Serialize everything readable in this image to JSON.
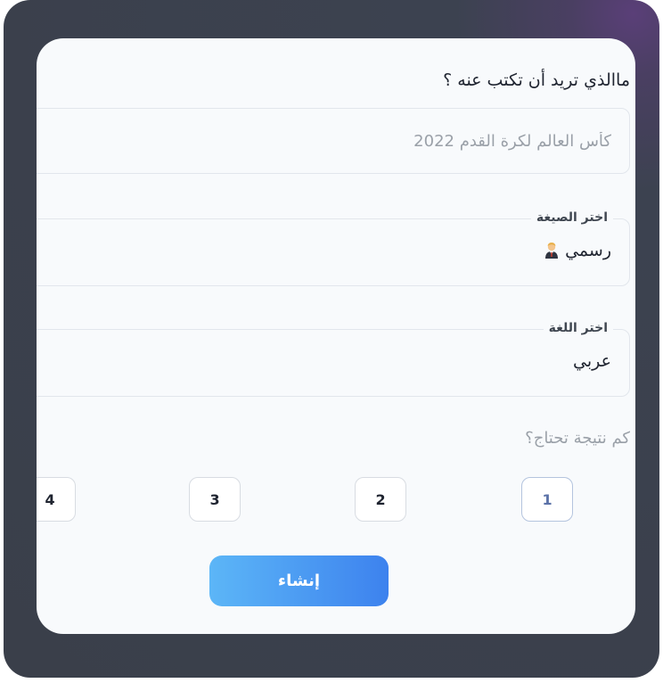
{
  "form": {
    "question": "ماالذي تريد أن تكتب عنه ؟",
    "topic_placeholder": "كأس العالم لكرة القدم 2022",
    "topic_value": "",
    "format": {
      "legend": "اختر الصيغة",
      "selected": "رسمي",
      "icon": "office-worker-icon"
    },
    "language": {
      "legend": "اختر اللغة",
      "selected": "عربي"
    },
    "results": {
      "label": "كم نتيجة تحتاج؟",
      "options": [
        "1",
        "2",
        "3",
        "4"
      ],
      "selected": "1"
    },
    "submit_label": "إنشاء"
  },
  "colors": {
    "accent_start": "#5cb6f7",
    "accent_end": "#3d82ee",
    "card_bg": "#f8fafc",
    "frame_bg": "#3a3f4a",
    "active_option": "#5b72a8"
  }
}
